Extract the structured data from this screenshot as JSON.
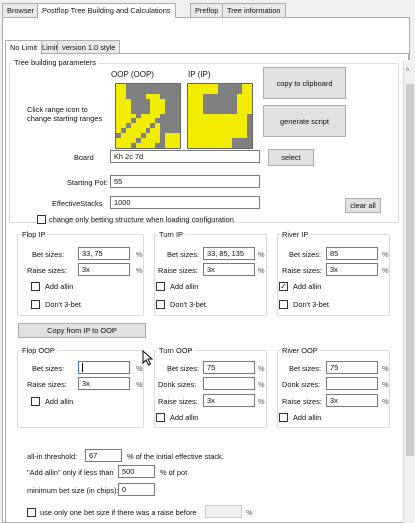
{
  "tabs_top": [
    "Browser",
    "Postflop Tree Building and Calculations",
    "Preflop",
    "Tree information"
  ],
  "tabs_sub": [
    "No Limit",
    "Limit",
    "version 1.0 style"
  ],
  "params": {
    "title": "Tree building parameters",
    "oop_label": "OOP (OOP)",
    "ip_label": "IP (IP)",
    "hint": "Click range icon to change starting ranges",
    "copy_clipboard": "copy to clipboard",
    "generate_script": "generate script",
    "board_label": "Board",
    "board_value": "Kh 2c 7d",
    "select": "select",
    "pot_label": "Starting Pot:",
    "pot_value": "55",
    "stacks_label": "EffectiveStacks",
    "stacks_value": "1000",
    "clear_all": "clear all",
    "change_only": "change only betting structure when loading configuration"
  },
  "flop_ip": {
    "title": "Flop IP",
    "bet_label": "Bet sizes:",
    "bet": "33, 75",
    "raise_label": "Raise sizes:",
    "raise": "3x",
    "add_allin": "Add allin",
    "dont3bet": "Don't 3-bet",
    "pct": "%"
  },
  "turn_ip": {
    "title": "Turn IP",
    "bet_label": "Bet sizes:",
    "bet": "33, 85, 135",
    "raise_label": "Raise sizes:",
    "raise": "3x",
    "add_allin": "Add allin",
    "dont3bet": "Don't 3-bet",
    "pct": "%"
  },
  "river_ip": {
    "title": "River IP",
    "bet_label": "Bet sizes:",
    "bet": "85",
    "raise_label": "Raise sizes:",
    "raise": "3x",
    "add_allin": "Add allin",
    "dont3bet": "Don't 3-bet",
    "pct": "%",
    "allin_checked": true
  },
  "copy_ip_oop": "Copy from IP to OOP",
  "flop_oop": {
    "title": "Flop OOP",
    "bet_label": "Bet sizes:",
    "bet": "",
    "raise_label": "Raise sizes:",
    "raise": "3x",
    "add_allin": "Add allin",
    "pct": "%"
  },
  "turn_oop": {
    "title": "Turn OOP",
    "bet_label": "Bet sizes:",
    "bet": "75",
    "donk_label": "Donk sizes:",
    "donk": "",
    "raise_label": "Raise sizes:",
    "raise": "3x",
    "add_allin": "Add allin",
    "pct": "%"
  },
  "river_oop": {
    "title": "River OOP",
    "bet_label": "Bet sizes:",
    "bet": "75",
    "donk_label": "Donk sizes:",
    "donk": "",
    "raise_label": "Raise sizes:",
    "raise": "3x",
    "add_allin": "Add allin",
    "pct": "%"
  },
  "bottom": {
    "allin_label": "all-in threshold:",
    "allin_value": "67",
    "allin_suffix": "% of the initial effective stack.",
    "addallin_label": "\"Add allin\" only if less than",
    "addallin_value": "500",
    "addallin_suffix": "% of pot",
    "minbet_label": "minimum bet size (in chips):",
    "minbet_value": "0",
    "one_bet_label": "use only one bet size if there was a raise before",
    "one_bet_pct": "%"
  }
}
